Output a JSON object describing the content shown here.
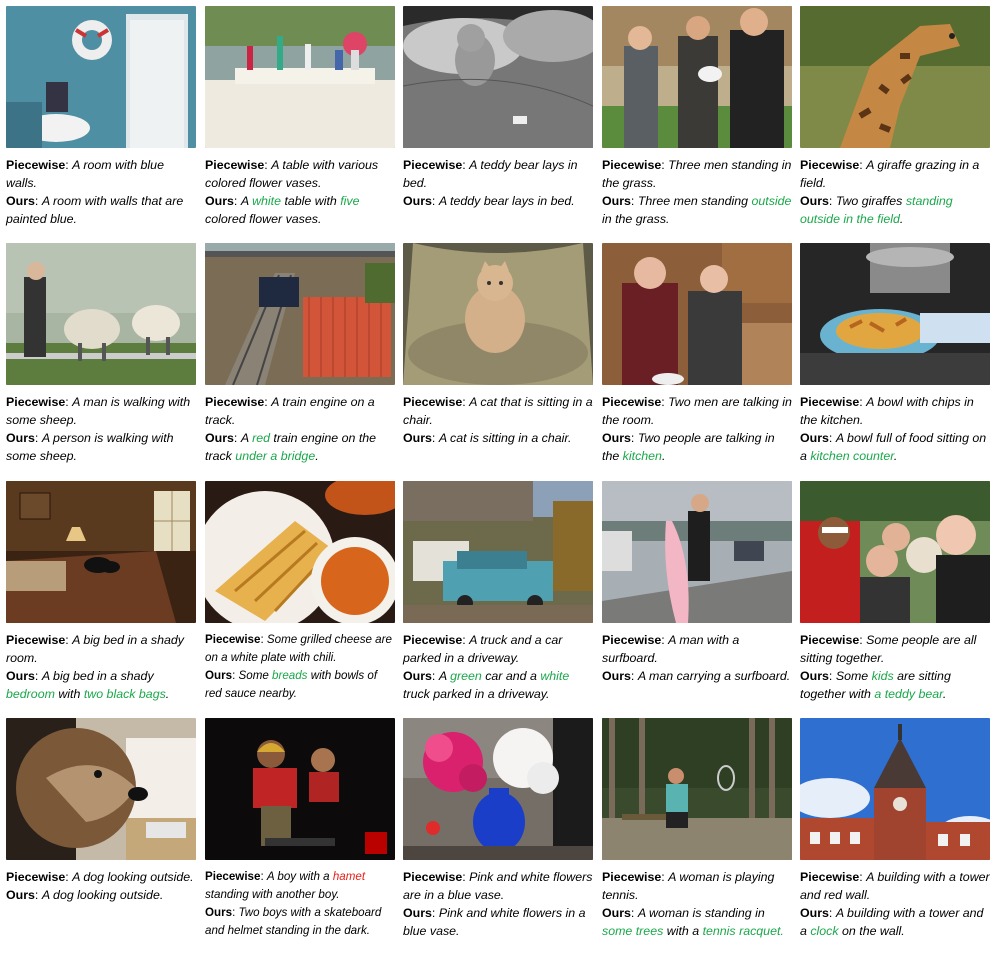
{
  "labels": {
    "piecewise": "Piecewise",
    "ours": "Ours"
  },
  "cells": [
    {
      "scene": "room-with-lifebuoy",
      "piecewise": [
        [
          "A room with blue walls.",
          ""
        ]
      ],
      "ours": [
        [
          "A room with walls that are painted blue.",
          ""
        ]
      ]
    },
    {
      "scene": "table-with-vases",
      "piecewise": [
        [
          "A table with various colored flower vases.",
          ""
        ]
      ],
      "ours": [
        [
          "A ",
          ""
        ],
        [
          "white",
          "g"
        ],
        [
          " table with ",
          ""
        ],
        [
          "five",
          "g"
        ],
        [
          " colored flower vases.",
          ""
        ]
      ]
    },
    {
      "scene": "teddy-bear-in-bed",
      "piecewise": [
        [
          "A teddy bear lays in bed.",
          ""
        ]
      ],
      "ours": [
        [
          "A teddy bear lays in bed.",
          ""
        ]
      ]
    },
    {
      "scene": "three-men-in-grass",
      "piecewise": [
        [
          "Three men standing in the grass.",
          ""
        ]
      ],
      "ours": [
        [
          "Three men standing ",
          ""
        ],
        [
          "outside",
          "g"
        ],
        [
          " in the grass.",
          ""
        ]
      ]
    },
    {
      "scene": "giraffe-in-field",
      "piecewise": [
        [
          "A giraffe grazing in a field.",
          ""
        ]
      ],
      "ours": [
        [
          "Two giraffes ",
          ""
        ],
        [
          "standing outside in the field",
          "g"
        ],
        [
          ".",
          ""
        ]
      ]
    },
    {
      "scene": "man-with-sheep",
      "piecewise": [
        [
          "A man is walking with some sheep.",
          ""
        ]
      ],
      "ours": [
        [
          "A person is walking with some sheep.",
          ""
        ]
      ]
    },
    {
      "scene": "train-under-bridge",
      "piecewise": [
        [
          "A train engine on a track.",
          ""
        ]
      ],
      "ours": [
        [
          "A ",
          ""
        ],
        [
          "red",
          "g"
        ],
        [
          " train engine on the track ",
          ""
        ],
        [
          "under a bridge",
          "g"
        ],
        [
          ".",
          ""
        ]
      ]
    },
    {
      "scene": "cat-in-chair",
      "piecewise": [
        [
          "A cat that is sitting in a chair.",
          ""
        ]
      ],
      "ours": [
        [
          "A cat is sitting in a chair.",
          ""
        ]
      ]
    },
    {
      "scene": "two-people-kitchen",
      "piecewise": [
        [
          "Two men are talking in the room.",
          ""
        ]
      ],
      "ours": [
        [
          "Two people are talking in the ",
          ""
        ],
        [
          "kitchen",
          "g"
        ],
        [
          ".",
          ""
        ]
      ]
    },
    {
      "scene": "bowl-of-chips",
      "piecewise": [
        [
          "A bowl with chips in the kitchen.",
          ""
        ]
      ],
      "ours": [
        [
          "A bowl full of food sitting on a ",
          ""
        ],
        [
          "kitchen counter",
          "g"
        ],
        [
          ".",
          ""
        ]
      ]
    },
    {
      "scene": "bed-in-room",
      "piecewise": [
        [
          "A big bed in a shady room.",
          ""
        ]
      ],
      "ours": [
        [
          "A big bed in a shady ",
          ""
        ],
        [
          "bedroom",
          "g"
        ],
        [
          " with ",
          ""
        ],
        [
          "two black bags",
          "g"
        ],
        [
          ".",
          ""
        ]
      ]
    },
    {
      "scene": "grilled-cheese-chili",
      "small": true,
      "piecewise": [
        [
          "Some grilled cheese are on a white plate with chili.",
          ""
        ]
      ],
      "ours": [
        [
          "Some ",
          ""
        ],
        [
          "breads",
          "g"
        ],
        [
          " with bowls of red sauce nearby.",
          ""
        ]
      ]
    },
    {
      "scene": "truck-and-car",
      "piecewise": [
        [
          "A truck and a car parked in a driveway.",
          ""
        ]
      ],
      "ours": [
        [
          "A ",
          ""
        ],
        [
          "green",
          "g"
        ],
        [
          " car and a ",
          ""
        ],
        [
          "white",
          "g"
        ],
        [
          " truck parked in a driveway.",
          ""
        ]
      ]
    },
    {
      "scene": "man-with-surfboard",
      "piecewise": [
        [
          "A man with a surfboard.",
          ""
        ]
      ],
      "ours": [
        [
          "A man carrying a surfboard.",
          ""
        ]
      ]
    },
    {
      "scene": "people-with-teddy",
      "piecewise": [
        [
          "Some people are all sitting together.",
          ""
        ]
      ],
      "ours": [
        [
          "Some ",
          ""
        ],
        [
          "kids",
          "g"
        ],
        [
          " are sitting together with ",
          ""
        ],
        [
          "a teddy bear",
          "g"
        ],
        [
          ".",
          ""
        ]
      ]
    },
    {
      "scene": "dog-looking-outside",
      "piecewise": [
        [
          "A dog looking outside.",
          ""
        ]
      ],
      "ours": [
        [
          "A dog looking outside.",
          ""
        ]
      ]
    },
    {
      "scene": "boys-in-dark",
      "small": true,
      "piecewise": [
        [
          "A boy with a ",
          ""
        ],
        [
          "hamet",
          "r"
        ],
        [
          " standing with another boy.",
          ""
        ]
      ],
      "ours": [
        [
          "Two boys with a skateboard and helmet standing in the dark.",
          ""
        ]
      ]
    },
    {
      "scene": "flowers-in-vase",
      "piecewise": [
        [
          "Pink and white flowers are in a blue vase.",
          ""
        ]
      ],
      "ours": [
        [
          "Pink and white flowers in a blue vase.",
          ""
        ]
      ]
    },
    {
      "scene": "woman-tennis",
      "piecewise": [
        [
          "A woman is playing tennis.",
          ""
        ]
      ],
      "ours": [
        [
          "A woman is standing in ",
          ""
        ],
        [
          "some trees",
          "g"
        ],
        [
          " with a ",
          ""
        ],
        [
          "tennis racquet.",
          "g"
        ]
      ]
    },
    {
      "scene": "building-with-tower",
      "piecewise": [
        [
          "A building with a tower and red wall.",
          ""
        ]
      ],
      "ours": [
        [
          "A building with a tower and a ",
          ""
        ],
        [
          "clock",
          "g"
        ],
        [
          " on the wall.",
          ""
        ]
      ]
    }
  ]
}
